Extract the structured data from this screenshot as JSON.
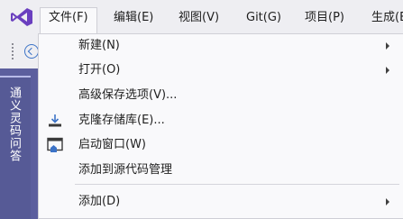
{
  "menubar": {
    "items": [
      {
        "label": "文件(F)"
      },
      {
        "label": "编辑(E)"
      },
      {
        "label": "视图(V)"
      },
      {
        "label": "Git(G)"
      },
      {
        "label": "项目(P)"
      },
      {
        "label": "生成(B"
      }
    ]
  },
  "side_panel": {
    "label": "通义灵码问答"
  },
  "file_menu": {
    "items": [
      {
        "label": "新建(N)",
        "submenu": true
      },
      {
        "label": "打开(O)",
        "submenu": true
      },
      {
        "label": "高级保存选项(V)..."
      },
      {
        "label": "克隆存储库(E)...",
        "icon": "clone-download-icon"
      },
      {
        "label": "启动窗口(W)",
        "icon": "start-window-icon"
      },
      {
        "label": "添加到源代码管理"
      },
      {
        "label": "添加(D)",
        "submenu": true
      }
    ]
  },
  "colors": {
    "accent_purple": "#6a3fbf",
    "side_panel": "#5c5f9e",
    "icon_blue": "#3c73c7"
  }
}
